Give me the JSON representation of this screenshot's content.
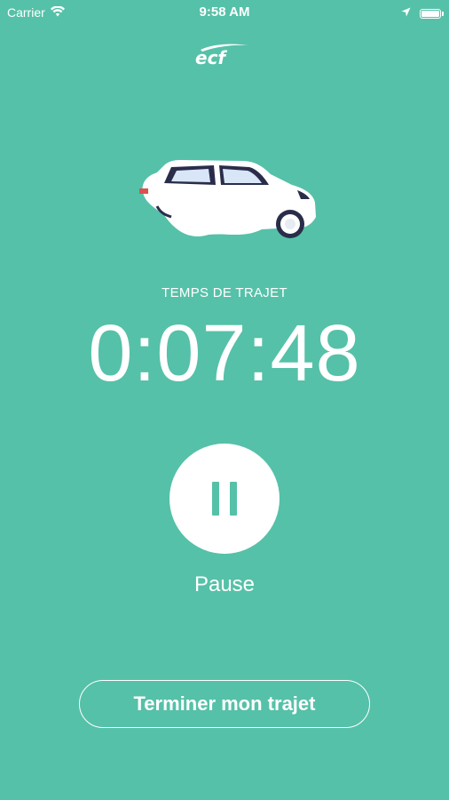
{
  "status_bar": {
    "carrier": "Carrier",
    "time": "9:58 AM",
    "icons": [
      "wifi-icon",
      "location-arrow-icon",
      "battery-icon"
    ]
  },
  "logo": {
    "text": "ecf"
  },
  "trip": {
    "label": "TEMPS DE TRAJET",
    "elapsed": "0:07:48"
  },
  "pause": {
    "label": "Pause",
    "icon": "pause-icon"
  },
  "finish": {
    "label": "Terminer mon trajet"
  },
  "colors": {
    "background": "#55c1a8",
    "foreground": "#ffffff",
    "car_dark": "#2a2d4a",
    "car_window": "#d8e6f7"
  }
}
